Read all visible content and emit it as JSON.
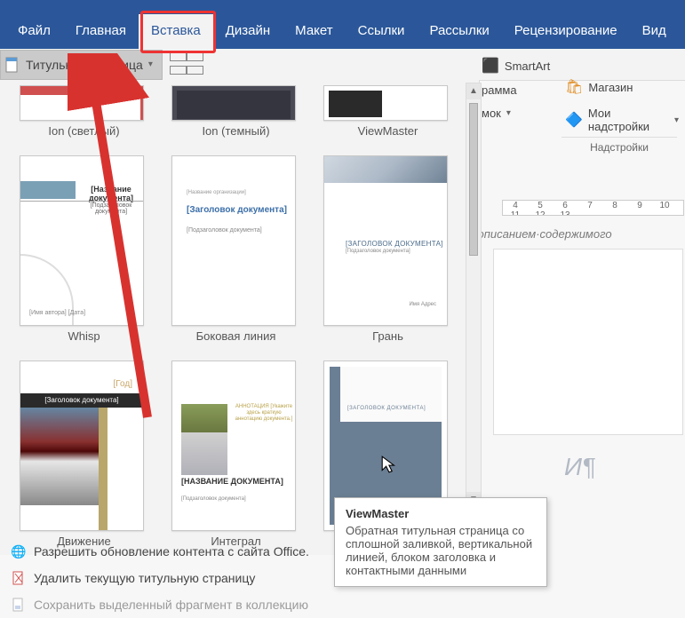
{
  "ribbon": {
    "tabs": [
      "Файл",
      "Главная",
      "Вставка",
      "Дизайн",
      "Макет",
      "Ссылки",
      "Рассылки",
      "Рецензирование",
      "Вид"
    ],
    "active_index": 2
  },
  "toolbar": {
    "cover_page_label": "Титульная страница",
    "table_label": "Таблица"
  },
  "right_commands": {
    "smartart": "SmartArt",
    "diagram_partial": "раммa",
    "snapshot_partial": "мок",
    "store": "Магазин",
    "addins": "Мои надстройки",
    "addins_section": "Надстройки"
  },
  "ruler_ticks": [
    "4",
    "5",
    "6",
    "7",
    "8",
    "9",
    "10",
    "11",
    "12",
    "13"
  ],
  "doc_snippet": "им·описанием·содержимого",
  "paragraph_mark": "И¶",
  "gallery": {
    "row1": [
      {
        "label": "Ion (светлый)"
      },
      {
        "label": "Ion (темный)"
      },
      {
        "label": "ViewMaster"
      }
    ],
    "row2": [
      {
        "label": "Whisp",
        "title": "[Название документа]",
        "sub": "[Подзаголовок документа]",
        "foot": "[Имя автора]\n[Дата]"
      },
      {
        "label": "Боковая линия",
        "top": "[Название организации]",
        "title": "[Заголовок документа]",
        "sub": "[Подзаголовок документа]"
      },
      {
        "label": "Грань",
        "title": "[Заголовок документа]",
        "sub": "[Подзаголовок документа]",
        "foot": "Имя\nАдрес"
      }
    ],
    "row3": [
      {
        "label": "Движение",
        "year": "[Год]",
        "bar": "[Заголовок документа]"
      },
      {
        "label": "Интеграл",
        "desc": "АННОТАЦИЯ\n[Укажите здесь краткую\nаннотацию документа.]",
        "title": "[НАЗВАНИЕ ДОКУМЕНТА]",
        "sub": "[Подзаголовок документа]"
      },
      {
        "label": "",
        "heading": "[ЗАГОЛОВОК ДОКУМЕНТА]"
      }
    ]
  },
  "footer": {
    "update": "Разрешить обновление контента с сайта Office.",
    "delete": "Удалить текущую титульную страницу",
    "save_selection": "Сохранить выделенный фрагмент в коллекцию"
  },
  "tooltip": {
    "title": "ViewMaster",
    "body": "Обратная титульная страница со сплошной заливкой, вертикальной линией, блоком заголовка и контактными данными"
  }
}
